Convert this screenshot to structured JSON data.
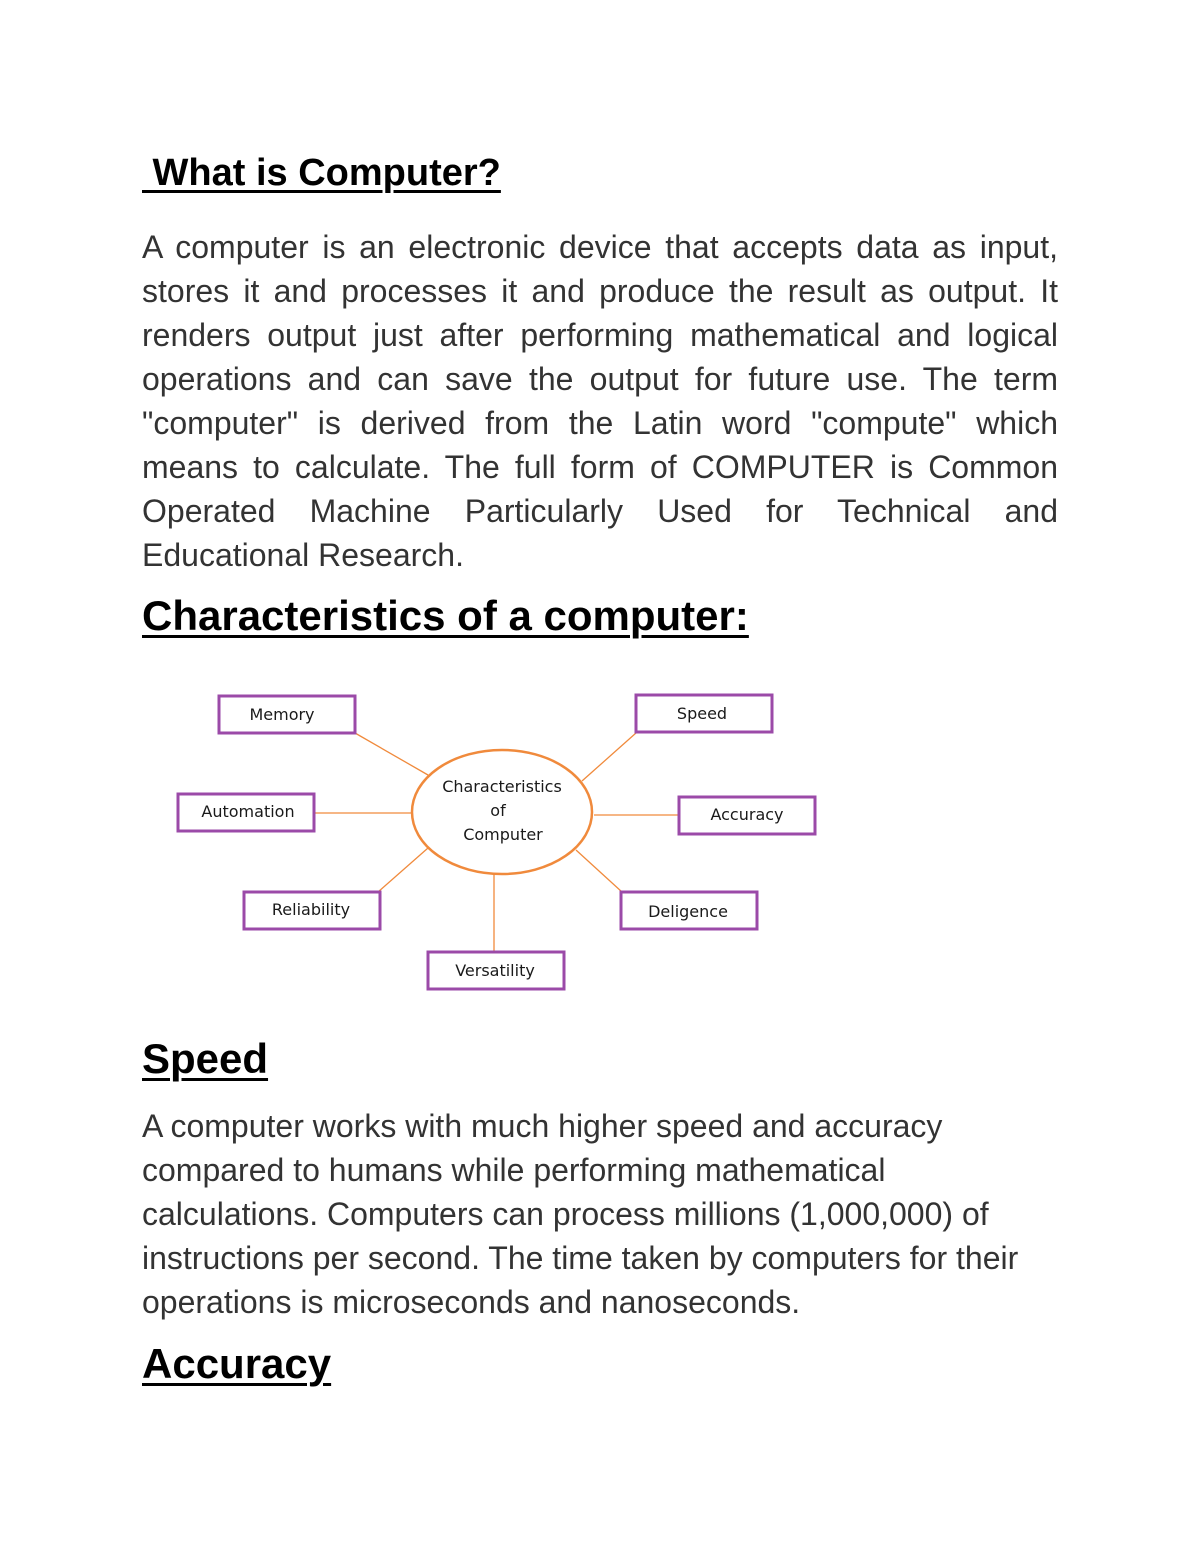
{
  "document": {
    "title": " What is Computer?",
    "intro_paragraph": "A computer is an electronic device that accepts data as input, stores it and processes it and produce the result as output. It renders output just after performing mathematical and logical operations and can save the output for future use. The term \"computer\" is derived from the Latin word \"compute\" which means to calculate. The full form of COMPUTER is Common Operated Machine Particularly Used for Technical and Educational Research.",
    "characteristics_heading": "Characteristics of a computer:",
    "diagram": {
      "center_lines": [
        "Characteristics",
        "of",
        "Computer"
      ],
      "nodes": {
        "memory": "Memory",
        "speed": "Speed",
        "automation": "Automation",
        "accuracy": "Accuracy",
        "reliability": "Reliability",
        "deligence": "Deligence",
        "versatility": "Versatility"
      },
      "colors": {
        "box_border": "#9b4aa8",
        "connector": "#f08a3c"
      }
    },
    "speed_heading": "Speed",
    "speed_paragraph": "A computer works with much higher speed and accuracy compared to humans while performing mathematical calculations. Computers can process millions (1,000,000) of instructions per second. The time taken by computers for their operations is microseconds and nanoseconds.",
    "accuracy_heading": "Accuracy"
  }
}
